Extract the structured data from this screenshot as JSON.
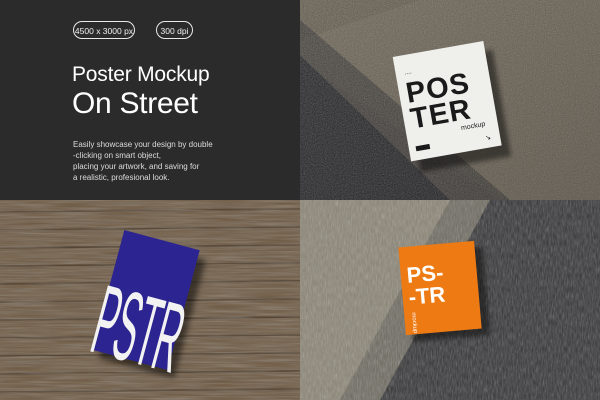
{
  "info": {
    "badge_size": "4500 x 3000 px",
    "badge_dpi": "300 dpi",
    "title_line1": "Poster Mockup",
    "title_line2": "On Street",
    "description": [
      "Easily showcase your design by double",
      "-clicking on smart object,",
      "placing your artwork, and saving for",
      "a realistic, profesional look."
    ]
  },
  "posters": {
    "white": {
      "line1": "POS",
      "line2": "TER",
      "sub": "mockup",
      "color": "#efefec",
      "text_color": "#1a1a1a"
    },
    "blue": {
      "text": "PSTR",
      "color": "#2c2490",
      "text_color": "#f2f2f2"
    },
    "orange": {
      "line1": "PS-",
      "line2": "-TR",
      "sub": "mockup",
      "color": "#ee7a14",
      "text_color": "#ffffff"
    }
  }
}
